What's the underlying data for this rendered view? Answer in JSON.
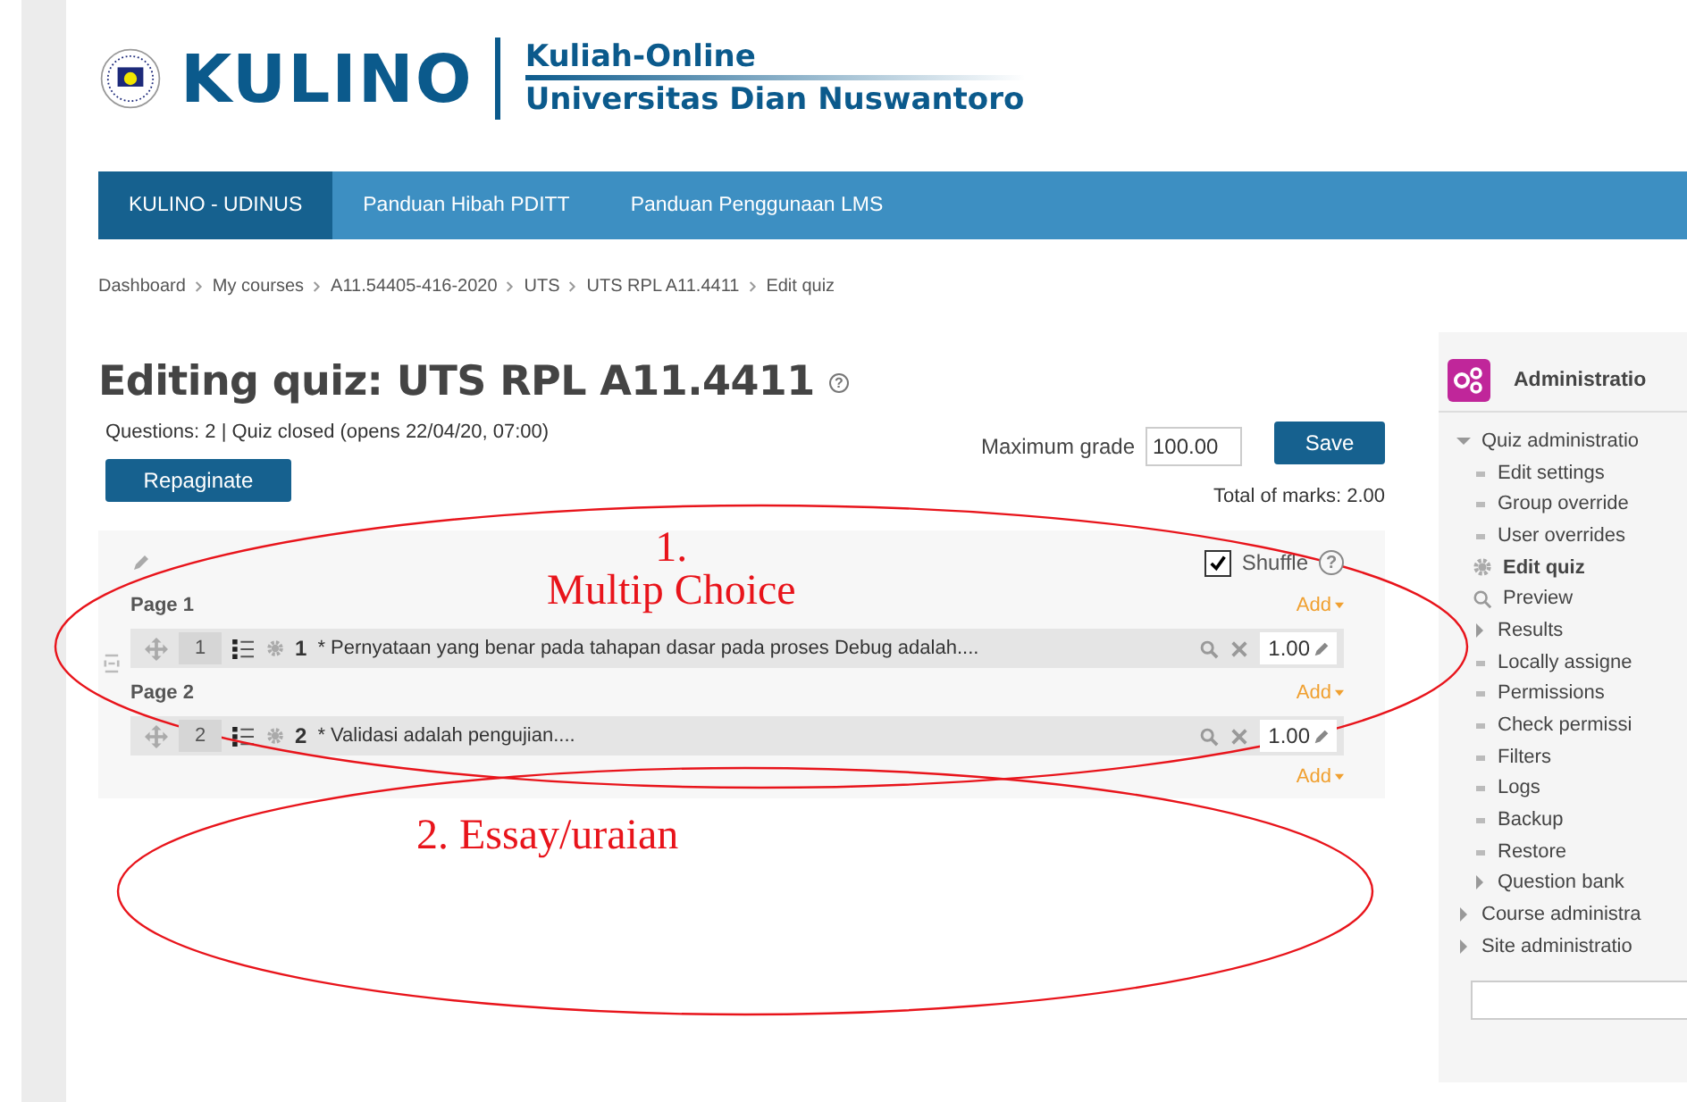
{
  "header": {
    "logo_text": "KULINO",
    "tagline": "Kuliah-Online",
    "institution": "Universitas Dian Nuswantoro"
  },
  "nav": [
    {
      "label": "KULINO - UDINUS",
      "selected": true
    },
    {
      "label": "Panduan Hibah PDITT",
      "selected": false
    },
    {
      "label": "Panduan Penggunaan LMS",
      "selected": false
    }
  ],
  "breadcrumb": [
    "Dashboard",
    "My courses",
    "A11.54405-416-2020",
    "UTS",
    "UTS RPL A11.4411",
    "Edit quiz"
  ],
  "title": "Editing quiz: UTS RPL A11.4411",
  "title_help": "?",
  "info": "Questions: 2 | Quiz closed (opens 22/04/20, 07:00)",
  "repaginate": "Repaginate",
  "max_grade": {
    "label": "Maximum grade",
    "value": "100.00"
  },
  "save": "Save",
  "total": "Total of marks: 2.00",
  "shuffle": {
    "label": "Shuffle",
    "checked": true,
    "help": "?"
  },
  "pages": [
    {
      "title": "Page 1",
      "add": "Add",
      "questions": [
        {
          "slot": "1",
          "number": "1",
          "text": "* Pernyataan yang benar pada tahapan dasar pada proses Debug adalah....",
          "mark": "1.00"
        }
      ]
    },
    {
      "title": "Page 2",
      "add": "Add",
      "questions": [
        {
          "slot": "2",
          "number": "2",
          "text": "* Validasi adalah pengujian....",
          "mark": "1.00"
        }
      ]
    }
  ],
  "final_add": "Add",
  "admin": {
    "title": "Administratio",
    "items": [
      {
        "label": "Quiz administratio",
        "kind": "branch",
        "expanded": true,
        "selected": false,
        "children": [
          {
            "label": "Edit settings",
            "kind": "leaf",
            "selected": false
          },
          {
            "label": "Group override",
            "kind": "leaf",
            "selected": false
          },
          {
            "label": "User overrides",
            "kind": "leaf",
            "selected": false
          },
          {
            "label": "Edit quiz",
            "kind": "gear",
            "selected": true
          },
          {
            "label": "Preview",
            "kind": "search",
            "selected": false
          },
          {
            "label": "Results",
            "kind": "branch",
            "expanded": false,
            "selected": false
          },
          {
            "label": "Locally assigne",
            "kind": "leaf",
            "selected": false
          },
          {
            "label": "Permissions",
            "kind": "leaf",
            "selected": false
          },
          {
            "label": "Check permissi",
            "kind": "leaf",
            "selected": false
          },
          {
            "label": "Filters",
            "kind": "leaf",
            "selected": false
          },
          {
            "label": "Logs",
            "kind": "leaf",
            "selected": false
          },
          {
            "label": "Backup",
            "kind": "leaf",
            "selected": false
          },
          {
            "label": "Restore",
            "kind": "leaf",
            "selected": false
          },
          {
            "label": "Question bank",
            "kind": "branch",
            "expanded": false,
            "selected": false
          }
        ]
      },
      {
        "label": "Course administra",
        "kind": "branch",
        "expanded": false,
        "selected": false
      },
      {
        "label": "Site administratio",
        "kind": "branch",
        "expanded": false,
        "selected": false
      }
    ]
  },
  "annotations": [
    {
      "lines": [
        "1.",
        "Multip Choice"
      ]
    },
    {
      "lines": [
        "2. Essay/uraian"
      ]
    }
  ]
}
